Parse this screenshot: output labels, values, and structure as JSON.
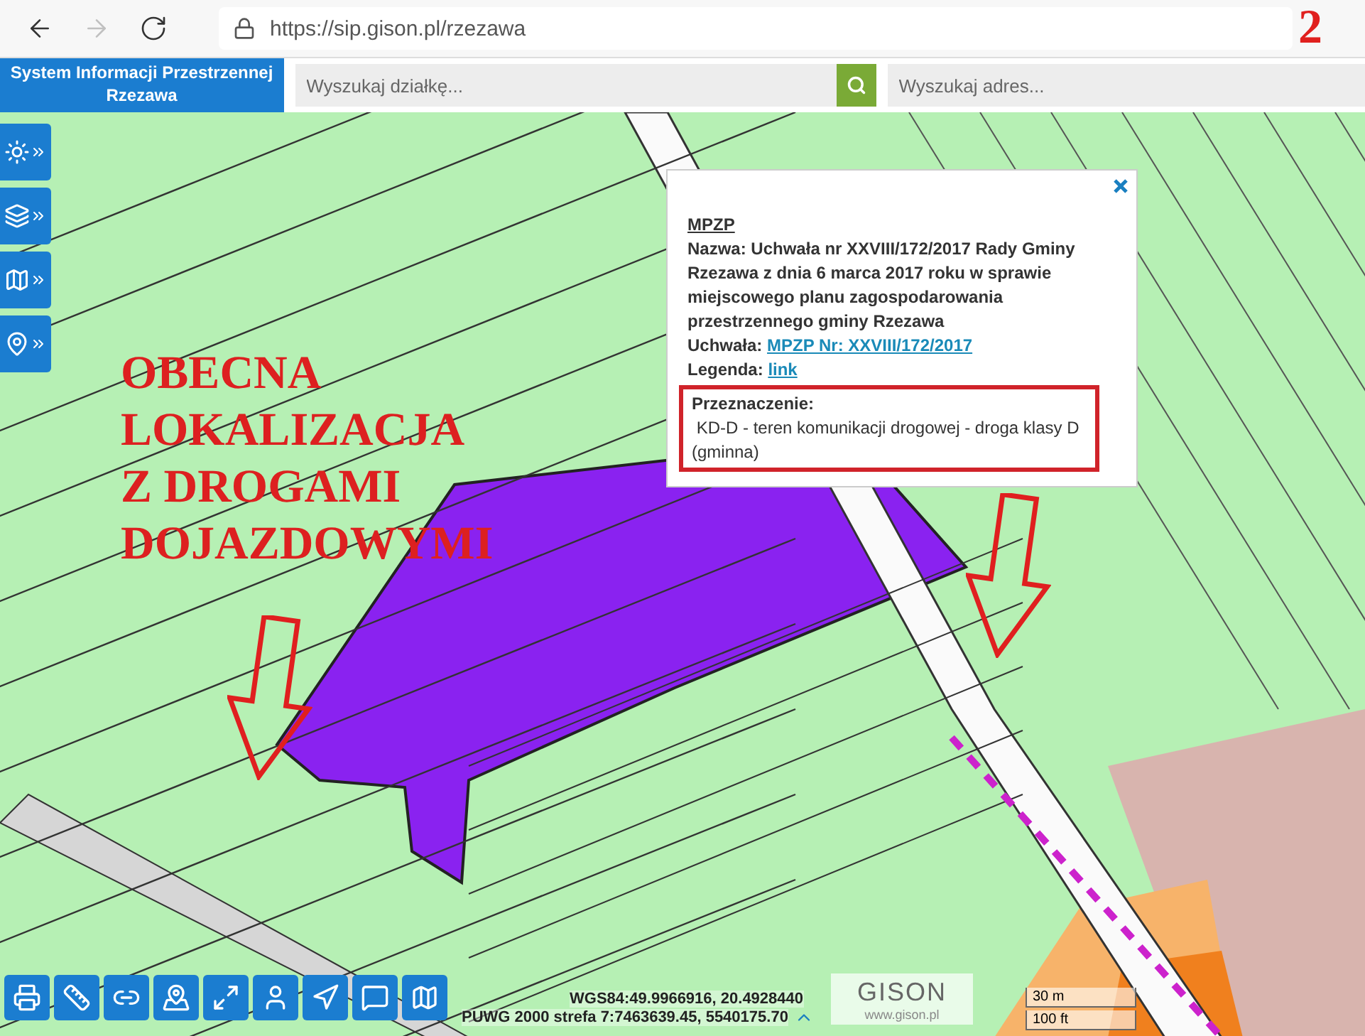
{
  "browser": {
    "nav": [
      {
        "kind": "back",
        "disabled": false
      },
      {
        "kind": "forward",
        "disabled": true
      },
      {
        "kind": "reload",
        "disabled": false
      }
    ],
    "url": "https://sip.gison.pl/rzezawa"
  },
  "annotation_number": "2",
  "header": {
    "title": "System Informacji Przestrzennej Rzezawa",
    "parcel_search": {
      "placeholder": "Wyszukaj działkę..."
    },
    "address_search": {
      "placeholder": "Wyszukaj adres..."
    }
  },
  "side_tools": [
    {
      "kind": "light"
    },
    {
      "kind": "layers"
    },
    {
      "kind": "map"
    },
    {
      "kind": "pin"
    }
  ],
  "annotation": {
    "lines": [
      "OBECNA",
      "LOKALIZACJA",
      "Z DROGAMI",
      "DOJAZDOWYMI"
    ]
  },
  "popup": {
    "heading": "MPZP",
    "fields": [
      {
        "kind": "text",
        "text": "Nazwa: Uchwała nr XXVIII/172/2017 Rady Gminy Rzezawa z dnia 6 marca 2017 roku w sprawie miejscowego planu zagospodarowania przestrzennego gminy Rzezawa"
      },
      {
        "kind": "link",
        "label": "Uchwała:",
        "value": "MPZP Nr: XXVIII/172/2017"
      },
      {
        "kind": "link",
        "label": "Legenda:",
        "value": "link"
      }
    ],
    "highlight": {
      "label": "Przeznaczenie:",
      "value": "KD-D - teren komunikacji drogowej - droga klasy D (gminna)"
    }
  },
  "bottom_tools": [
    {
      "kind": "print"
    },
    {
      "kind": "measure"
    },
    {
      "kind": "link"
    },
    {
      "kind": "pin"
    },
    {
      "kind": "expand"
    },
    {
      "kind": "info"
    },
    {
      "kind": "navigate"
    },
    {
      "kind": "comment"
    },
    {
      "kind": "map"
    }
  ],
  "coordinates": {
    "wgs84": "WGS84:49.9966916, 20.4928440",
    "puwg": "PUWG 2000 strefa 7:7463639.45, 5540175.70"
  },
  "logo": {
    "name": "GISON",
    "url": "www.gison.pl"
  },
  "scale": [
    "30 m",
    "100 ft"
  ]
}
